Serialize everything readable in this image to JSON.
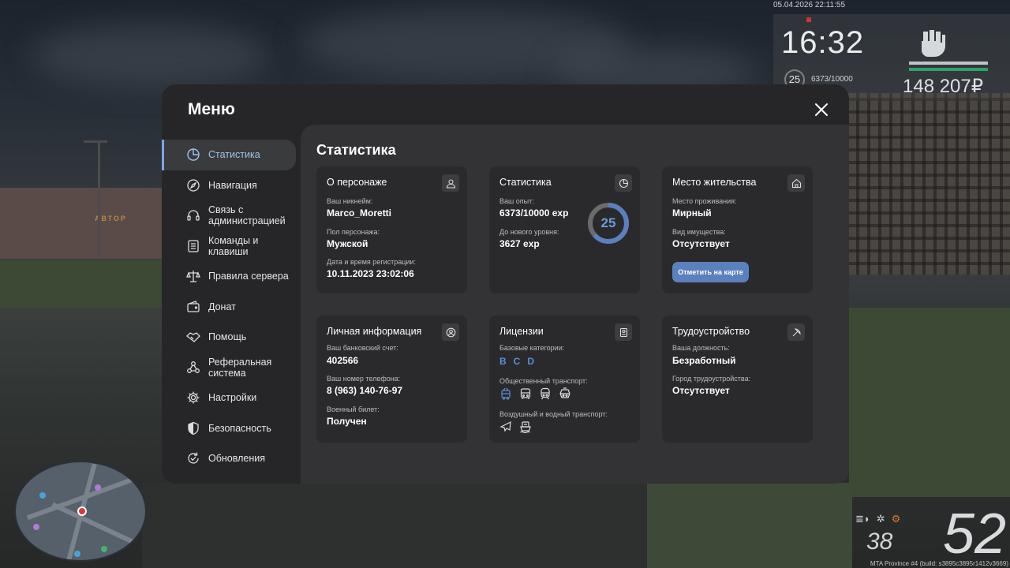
{
  "hud": {
    "datetime": "05.04.2026 22:11:55",
    "time": "16:32",
    "level": "25",
    "exp": "6373/10000",
    "money": "148 207₽",
    "speed": "52",
    "fuel": "38",
    "build": "MTA Province #4 (build: s3895c3895r1412v3669)",
    "map_sign": "АВТОР"
  },
  "menu": {
    "title": "Меню",
    "nav": [
      {
        "label": "Статистика",
        "icon": "pie-chart-icon"
      },
      {
        "label": "Навигация",
        "icon": "compass-icon"
      },
      {
        "label": "Связь с администрацией",
        "icon": "headset-icon"
      },
      {
        "label": "Команды и клавиши",
        "icon": "list-icon"
      },
      {
        "label": "Правила сервера",
        "icon": "scales-icon"
      },
      {
        "label": "Донат",
        "icon": "wallet-icon"
      },
      {
        "label": "Помощь",
        "icon": "handshake-icon"
      },
      {
        "label": "Реферальная система",
        "icon": "network-icon"
      },
      {
        "label": "Настройки",
        "icon": "gear-icon"
      },
      {
        "label": "Безопасность",
        "icon": "shield-icon"
      },
      {
        "label": "Обновления",
        "icon": "refresh-icon"
      }
    ]
  },
  "content": {
    "title": "Статистика",
    "character": {
      "title": "О персонаже",
      "nick_label": "Ваш никнейм:",
      "nick": "Marco_Moretti",
      "gender_label": "Пол персонажа:",
      "gender": "Мужской",
      "reg_label": "Дата и время регистрации:",
      "reg": "10.11.2023 23:02:06"
    },
    "stats": {
      "title": "Статистика",
      "exp_label": "Ваш опыт:",
      "exp": "6373/10000 exp",
      "next_label": "До нового уровня:",
      "next": "3627 exp",
      "level": "25",
      "progress": 0.6373
    },
    "residence": {
      "title": "Место жительства",
      "place_label": "Место проживания:",
      "place": "Мирный",
      "property_label": "Вид имущества:",
      "property": "Отсутствует",
      "button": "Отметить на карте"
    },
    "personal": {
      "title": "Личная информация",
      "bank_label": "Ваш банковский счет:",
      "bank": "402566",
      "phone_label": "Ваш номер телефона:",
      "phone": "8 (963) 140-76-97",
      "military_label": "Военный билет:",
      "military": "Получен"
    },
    "licenses": {
      "title": "Лицензии",
      "base_label": "Базовые категории:",
      "categories": [
        "B",
        "C",
        "D"
      ],
      "public_label": "Общественный транспорт:",
      "air_label": "Воздушный и водный транспорт:"
    },
    "job": {
      "title": "Трудоустройство",
      "position_label": "Ваша должность:",
      "position": "Безработный",
      "city_label": "Город трудоустройства:",
      "city": "Отсутствует"
    }
  },
  "colors": {
    "accent": "#5a80bd",
    "accent_text": "#6f98d8",
    "panel": "#262628",
    "card": "#2a2a2c"
  }
}
